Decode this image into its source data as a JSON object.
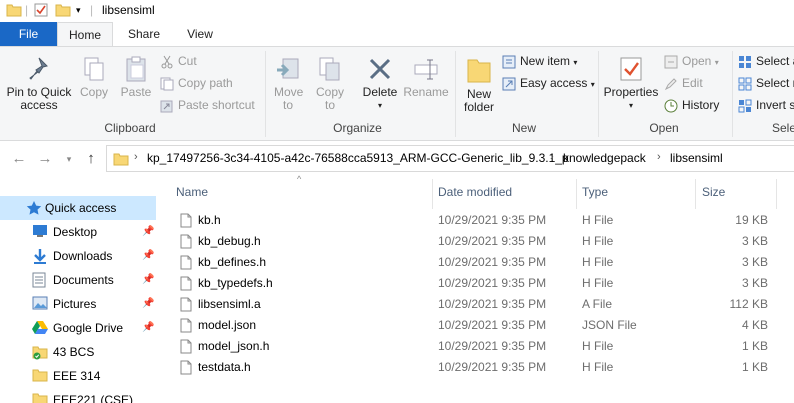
{
  "window": {
    "title": "libsensiml"
  },
  "tabs": [
    {
      "label": "File"
    },
    {
      "label": "Home"
    },
    {
      "label": "Share"
    },
    {
      "label": "View"
    }
  ],
  "ribbon": {
    "clipboard": {
      "label": "Clipboard",
      "pin": "Pin to Quick access",
      "copy": "Copy",
      "paste": "Paste",
      "cut": "Cut",
      "copy_path": "Copy path",
      "paste_shortcut": "Paste shortcut"
    },
    "organize": {
      "label": "Organize",
      "move_to": "Move to",
      "copy_to": "Copy to",
      "delete": "Delete",
      "rename": "Rename"
    },
    "new": {
      "label": "New",
      "new_folder": "New folder",
      "new_item": "New item",
      "easy_access": "Easy access"
    },
    "open": {
      "label": "Open",
      "properties": "Properties",
      "open": "Open",
      "edit": "Edit",
      "history": "History"
    },
    "select": {
      "label": "Sele",
      "select_all": "Select a",
      "select_none": "Select n",
      "invert": "Invert s"
    }
  },
  "address": {
    "crumbs": [
      "kp_17497256-3c34-4105-a42c-76588cca5913_ARM-GCC-Generic_lib_9.3.1_p",
      "knowledgepack",
      "libsensiml"
    ]
  },
  "nav_pane": {
    "items": [
      {
        "label": "Quick access",
        "icon": "star-icon",
        "selected": true,
        "pinned": false
      },
      {
        "label": "Desktop",
        "icon": "desktop-icon",
        "selected": false,
        "pinned": true
      },
      {
        "label": "Downloads",
        "icon": "download-icon",
        "selected": false,
        "pinned": true
      },
      {
        "label": "Documents",
        "icon": "documents-icon",
        "selected": false,
        "pinned": true
      },
      {
        "label": "Pictures",
        "icon": "pictures-icon",
        "selected": false,
        "pinned": true
      },
      {
        "label": "Google Drive",
        "icon": "google-drive-icon",
        "selected": false,
        "pinned": true
      },
      {
        "label": "43 BCS",
        "icon": "folder-check-icon",
        "selected": false,
        "pinned": false
      },
      {
        "label": "EEE 314",
        "icon": "folder-icon",
        "selected": false,
        "pinned": false
      },
      {
        "label": "EEE221 (CSE)",
        "icon": "folder-icon",
        "selected": false,
        "pinned": false
      }
    ]
  },
  "file_list": {
    "columns": {
      "name": "Name",
      "date": "Date modified",
      "type": "Type",
      "size": "Size"
    },
    "rows": [
      {
        "name": "kb.h",
        "date": "10/29/2021 9:35 PM",
        "type": "H File",
        "size": "19 KB"
      },
      {
        "name": "kb_debug.h",
        "date": "10/29/2021 9:35 PM",
        "type": "H File",
        "size": "3 KB"
      },
      {
        "name": "kb_defines.h",
        "date": "10/29/2021 9:35 PM",
        "type": "H File",
        "size": "3 KB"
      },
      {
        "name": "kb_typedefs.h",
        "date": "10/29/2021 9:35 PM",
        "type": "H File",
        "size": "3 KB"
      },
      {
        "name": "libsensiml.a",
        "date": "10/29/2021 9:35 PM",
        "type": "A File",
        "size": "112 KB"
      },
      {
        "name": "model.json",
        "date": "10/29/2021 9:35 PM",
        "type": "JSON File",
        "size": "4 KB"
      },
      {
        "name": "model_json.h",
        "date": "10/29/2021 9:35 PM",
        "type": "H File",
        "size": "1 KB"
      },
      {
        "name": "testdata.h",
        "date": "10/29/2021 9:35 PM",
        "type": "H File",
        "size": "1 KB"
      }
    ]
  },
  "colors": {
    "accent": "#1a68c6",
    "selected": "#cce8ff",
    "folder": "#f8d775"
  }
}
